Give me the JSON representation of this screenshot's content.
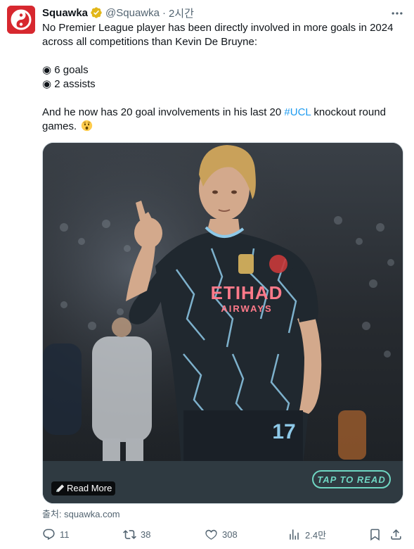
{
  "author": {
    "display_name": "Squawka",
    "handle": "@Squawka",
    "separator": "·",
    "time": "2시간",
    "avatar_icon": "squawka-logo-icon",
    "avatar_color": "#d7282f",
    "verified_color": "#e2b719"
  },
  "tweet": {
    "line1": "No Premier League player has been directly involved in more goals in 2024",
    "line2": "across all competitions than Kevin De Bruyne:",
    "bullet1": "◉ 6 goals",
    "bullet2": "◉ 2 assists",
    "closing_text": "And he now has 20 goal involvements in his last 20 ",
    "hashtag": "#UCL",
    "closing_rest": " knockout round",
    "closing_line2": "games.",
    "emoji": "astonished-face-icon"
  },
  "media": {
    "jersey_sponsor": "ETIHAD",
    "jersey_sponsor_sub": "AIRWAYS",
    "jersey_number": "17",
    "read_more": "Read More",
    "tap_to_read": "TAP TO READ",
    "accent_color": "#6fd6c2"
  },
  "source": {
    "label": "출처: squawka.com"
  },
  "actions": {
    "replies": "11",
    "retweets": "38",
    "likes": "308",
    "views": "2.4만"
  }
}
